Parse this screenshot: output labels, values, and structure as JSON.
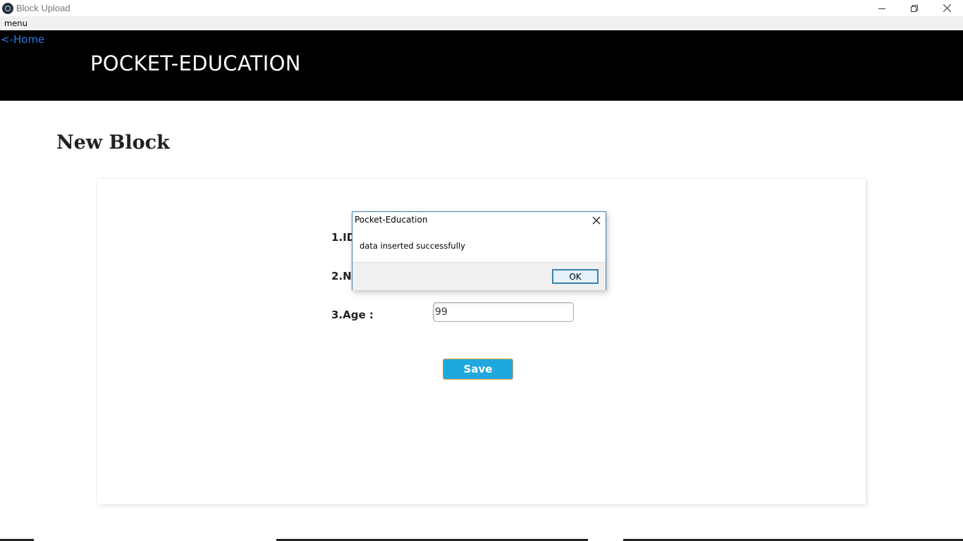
{
  "window": {
    "title": "Block Upload"
  },
  "menubar": {
    "menu_label": "menu"
  },
  "header": {
    "home_link": "<-Home",
    "brand": "POCKET-EDUCATION"
  },
  "page": {
    "title": "New Block"
  },
  "form": {
    "id_label": "1.ID",
    "name_label": "2.Na",
    "age_label": "3.Age :",
    "age_value": "99",
    "save_label": "Save"
  },
  "dialog": {
    "title": "Pocket-Education",
    "message": "data inserted successfully",
    "ok_label": "OK"
  },
  "colors": {
    "header_bg": "#000000",
    "link": "#2a7de1",
    "save_button": "#1fa8de",
    "dialog_border": "#3c7fb1"
  }
}
